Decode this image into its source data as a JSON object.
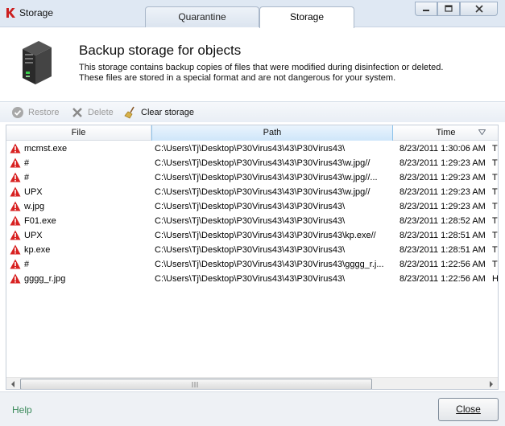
{
  "window": {
    "title": "Storage",
    "brand_color": "#cc1f1f"
  },
  "tabs": [
    {
      "label": "Quarantine",
      "active": false
    },
    {
      "label": "Storage",
      "active": true
    }
  ],
  "header": {
    "title": "Backup storage for objects",
    "description_line1": "This storage contains backup copies of files that were modified during disinfection or deleted.",
    "description_line2": "These files are stored in a special format and are not dangerous for your system.",
    "icon": "server-icon"
  },
  "toolbar": {
    "restore_label": "Restore",
    "delete_label": "Delete",
    "clear_label": "Clear storage"
  },
  "table": {
    "columns": {
      "file": "File",
      "path": "Path",
      "time": "Time"
    },
    "rows": [
      {
        "file": "mcmst.exe",
        "path": "C:\\Users\\Tj\\Desktop\\P30Virus43\\43\\P30Virus43\\",
        "time": "8/23/2011 1:30:06 AM",
        "extra": "Tr"
      },
      {
        "file": "#",
        "path": "C:\\Users\\Tj\\Desktop\\P30Virus43\\43\\P30Virus43\\w.jpg//",
        "time": "8/23/2011 1:29:23 AM",
        "extra": "Tr"
      },
      {
        "file": "#",
        "path": "C:\\Users\\Tj\\Desktop\\P30Virus43\\43\\P30Virus43\\w.jpg//...",
        "time": "8/23/2011 1:29:23 AM",
        "extra": "Tr"
      },
      {
        "file": "UPX",
        "path": "C:\\Users\\Tj\\Desktop\\P30Virus43\\43\\P30Virus43\\w.jpg//",
        "time": "8/23/2011 1:29:23 AM",
        "extra": "Tr"
      },
      {
        "file": "w.jpg",
        "path": "C:\\Users\\Tj\\Desktop\\P30Virus43\\43\\P30Virus43\\",
        "time": "8/23/2011 1:29:23 AM",
        "extra": "Tr"
      },
      {
        "file": "F01.exe",
        "path": "C:\\Users\\Tj\\Desktop\\P30Virus43\\43\\P30Virus43\\",
        "time": "8/23/2011 1:28:52 AM",
        "extra": "Tr"
      },
      {
        "file": "UPX",
        "path": "C:\\Users\\Tj\\Desktop\\P30Virus43\\43\\P30Virus43\\kp.exe//",
        "time": "8/23/2011 1:28:51 AM",
        "extra": "Tr"
      },
      {
        "file": "kp.exe",
        "path": "C:\\Users\\Tj\\Desktop\\P30Virus43\\43\\P30Virus43\\",
        "time": "8/23/2011 1:28:51 AM",
        "extra": "Tr"
      },
      {
        "file": "#",
        "path": "C:\\Users\\Tj\\Desktop\\P30Virus43\\43\\P30Virus43\\gggg_r.j...",
        "time": "8/23/2011 1:22:56 AM",
        "extra": "Tr"
      },
      {
        "file": "gggg_r.jpg",
        "path": "C:\\Users\\Tj\\Desktop\\P30Virus43\\43\\P30Virus43\\",
        "time": "8/23/2011 1:22:56 AM",
        "extra": "H"
      }
    ]
  },
  "footer": {
    "help_label": "Help",
    "close_label": "Close"
  }
}
